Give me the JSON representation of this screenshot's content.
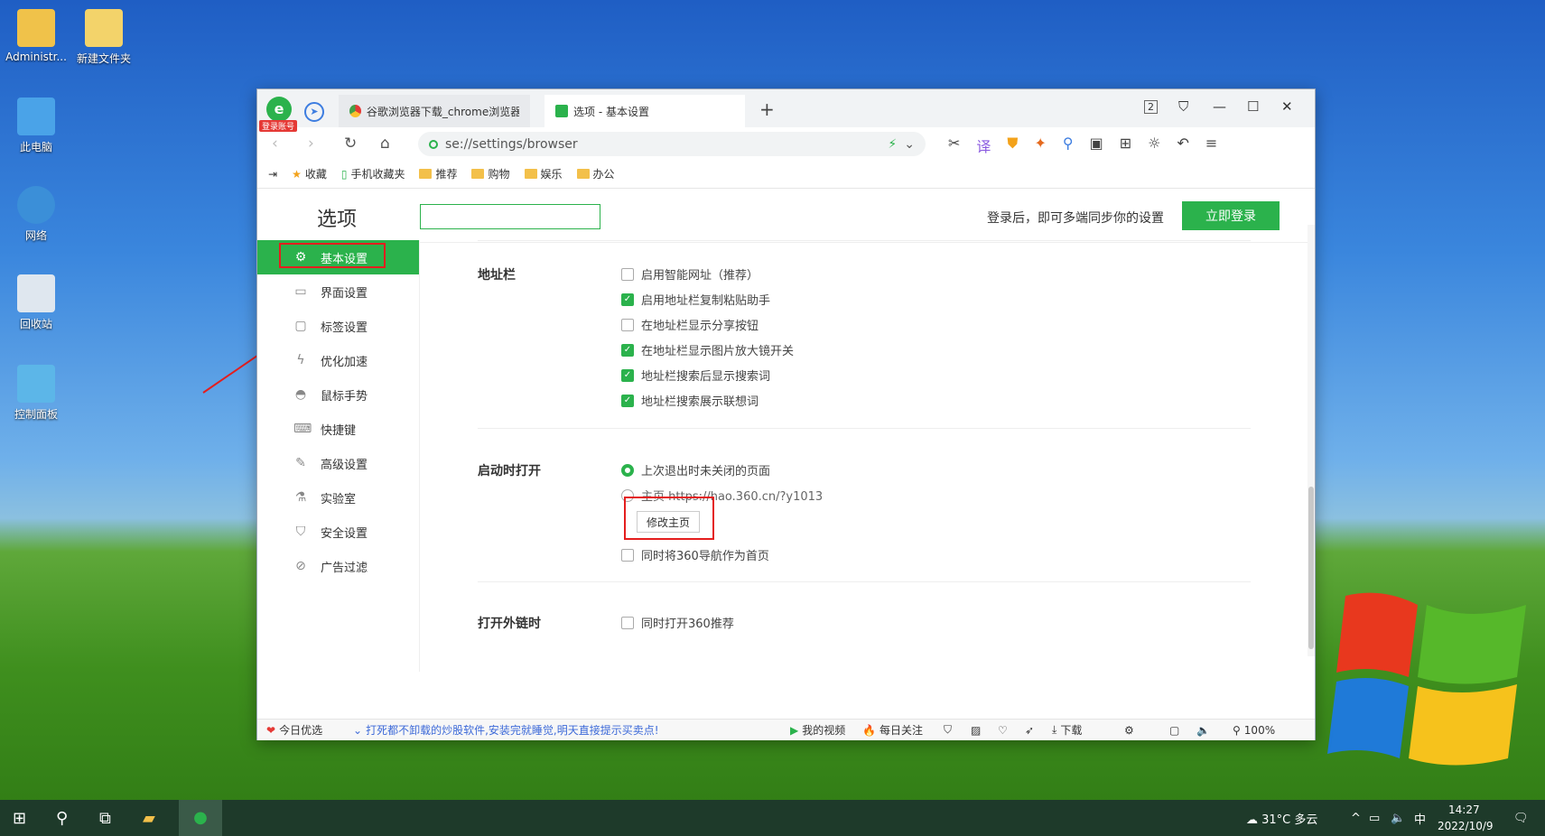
{
  "desktop": {
    "icons": [
      {
        "label": "Administr..."
      },
      {
        "label": "新建文件夹"
      },
      {
        "label": "此电脑"
      },
      {
        "label": "网络"
      },
      {
        "label": "回收站"
      },
      {
        "label": "控制面板"
      }
    ]
  },
  "browser": {
    "login_badge": "登录账号",
    "tabs": [
      {
        "label": "谷歌浏览器下载_chrome浏览器官"
      },
      {
        "label": "选项 - 基本设置"
      }
    ],
    "tab_count": "2",
    "address": "se://settings/browser",
    "bookmarks": [
      "收藏",
      "手机收藏夹",
      "推荐",
      "购物",
      "娱乐",
      "办公"
    ]
  },
  "options": {
    "title": "选项",
    "search_placeholder": "",
    "sync_text": "登录后，即可多端同步你的设置",
    "login_button": "立即登录",
    "sidebar": [
      {
        "label": "基本设置",
        "icon": "gear-icon",
        "active": true
      },
      {
        "label": "界面设置",
        "icon": "window-icon"
      },
      {
        "label": "标签设置",
        "icon": "tab-icon"
      },
      {
        "label": "优化加速",
        "icon": "bolt-icon"
      },
      {
        "label": "鼠标手势",
        "icon": "mouse-icon"
      },
      {
        "label": "快捷键",
        "icon": "keyboard-icon"
      },
      {
        "label": "高级设置",
        "icon": "wrench-icon"
      },
      {
        "label": "实验室",
        "icon": "flask-icon"
      },
      {
        "label": "安全设置",
        "icon": "shield-icon"
      },
      {
        "label": "广告过滤",
        "icon": "block-icon"
      }
    ],
    "sections": {
      "addressbar": {
        "title": "地址栏",
        "options": [
          {
            "label": "启用智能网址（推荐）",
            "checked": false
          },
          {
            "label": "启用地址栏复制粘贴助手",
            "checked": true
          },
          {
            "label": "在地址栏显示分享按钮",
            "checked": false
          },
          {
            "label": "在地址栏显示图片放大镜开关",
            "checked": true
          },
          {
            "label": "地址栏搜索后显示搜索词",
            "checked": true
          },
          {
            "label": "地址栏搜索展示联想词",
            "checked": true
          }
        ]
      },
      "startup": {
        "title": "启动时打开",
        "radio1": "上次退出时未关闭的页面",
        "radio2": "主页 https://hao.360.cn/?y1013",
        "modify_button": "修改主页",
        "also_check": "同时将360导航作为首页"
      },
      "external": {
        "title": "打开外链时",
        "option": "同时打开360推荐"
      }
    }
  },
  "statusbar": {
    "today": "今日优选",
    "news": "打死都不卸载的炒股软件,安装完就睡觉,明天直接提示买卖点!",
    "video": "我的视频",
    "daily": "每日关注",
    "download": "下载",
    "zoom": "100%"
  },
  "taskbar": {
    "weather": "31°C 多云",
    "ime": "中",
    "time": "14:27",
    "date": "2022/10/9"
  }
}
